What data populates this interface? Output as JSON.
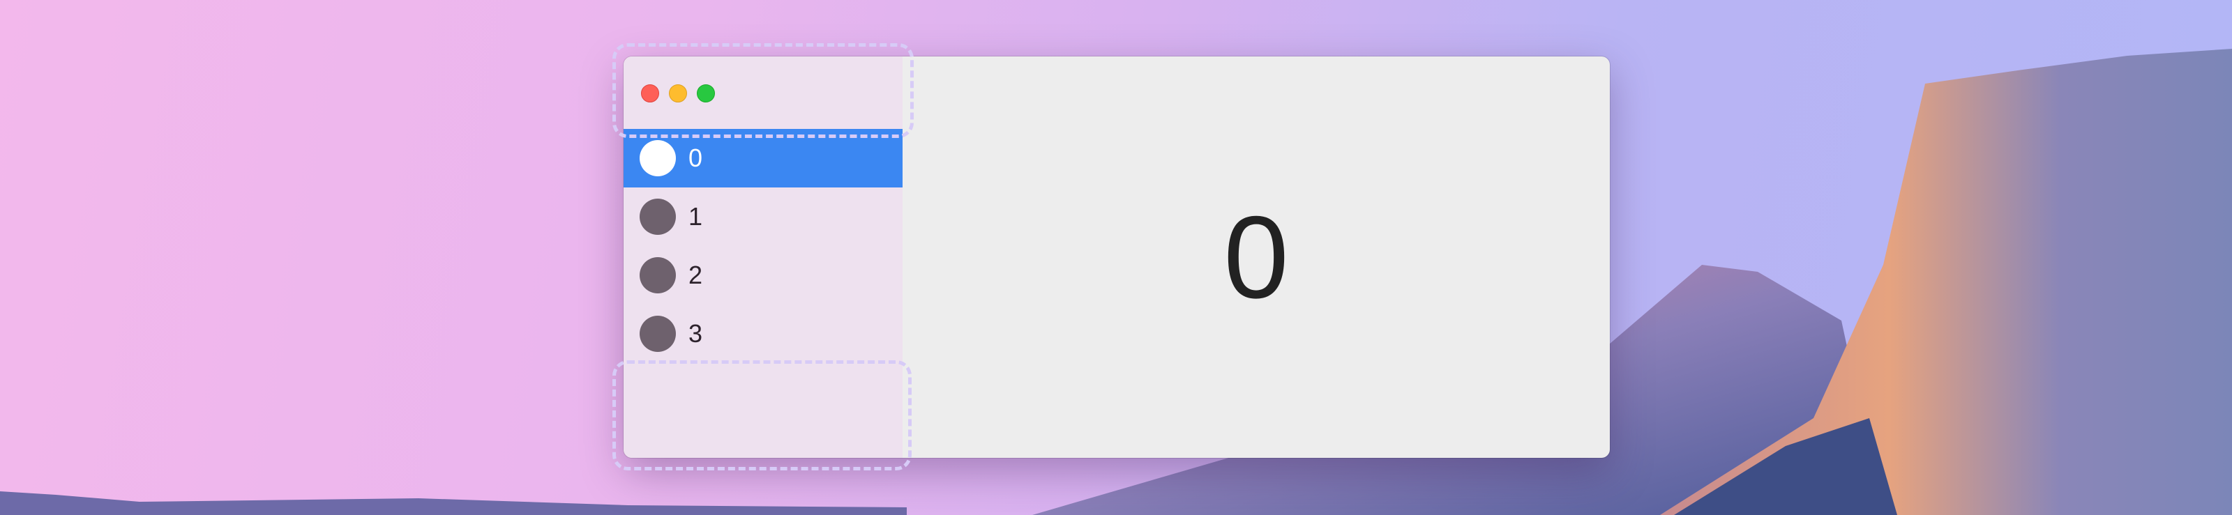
{
  "window": {
    "traffic_lights": [
      {
        "name": "close",
        "color": "#fe5f57"
      },
      {
        "name": "minimize",
        "color": "#febc2e"
      },
      {
        "name": "zoom",
        "color": "#28c840"
      }
    ],
    "sidebar": {
      "selected_index": 0,
      "items": [
        {
          "label": "0"
        },
        {
          "label": "1"
        },
        {
          "label": "2"
        },
        {
          "label": "3"
        }
      ]
    },
    "detail": {
      "value": "0"
    }
  },
  "colors": {
    "accent": "#3b87f2",
    "sidebar_bg": "#eee1ef",
    "content_bg": "#ededed"
  }
}
